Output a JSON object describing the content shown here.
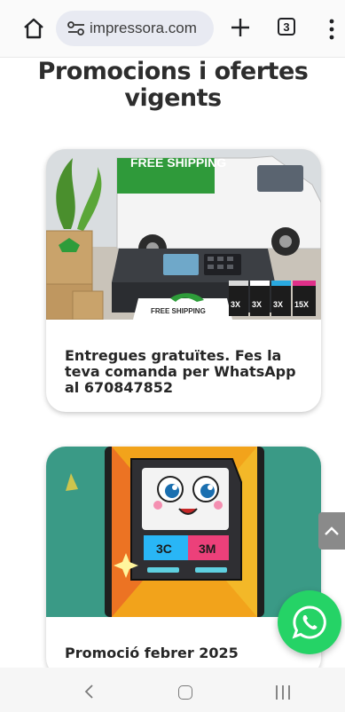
{
  "browser": {
    "url": "impressora.com",
    "tab_count": "3",
    "icons": [
      "home-icon",
      "site-settings-icon",
      "new-tab-icon",
      "tab-switcher-icon",
      "more-menu-icon"
    ]
  },
  "page": {
    "title": "Promocions i ofertes vigents"
  },
  "promotions": [
    {
      "text": "Entregues gratuïtes. Fes la teva comanda per WhatsApp al 670847852",
      "image_text": {
        "banner": "FREE SHIPPING",
        "paper": "FREE SHIPPING",
        "cartridges": [
          "3X",
          "3X",
          "3X",
          "15X"
        ]
      }
    },
    {
      "text": "Promoció febrer 2025",
      "image_text": {
        "label_left": "3C",
        "label_right": "3M"
      }
    }
  ],
  "colors": {
    "whatsapp": "#25d366",
    "card2_background": "#3a9a86"
  },
  "floating": {
    "scroll_top_icon": "chevron-up-icon",
    "whatsapp_icon": "whatsapp-icon"
  },
  "navbar": {
    "icons": [
      "back-icon",
      "home-icon",
      "recents-icon"
    ]
  }
}
